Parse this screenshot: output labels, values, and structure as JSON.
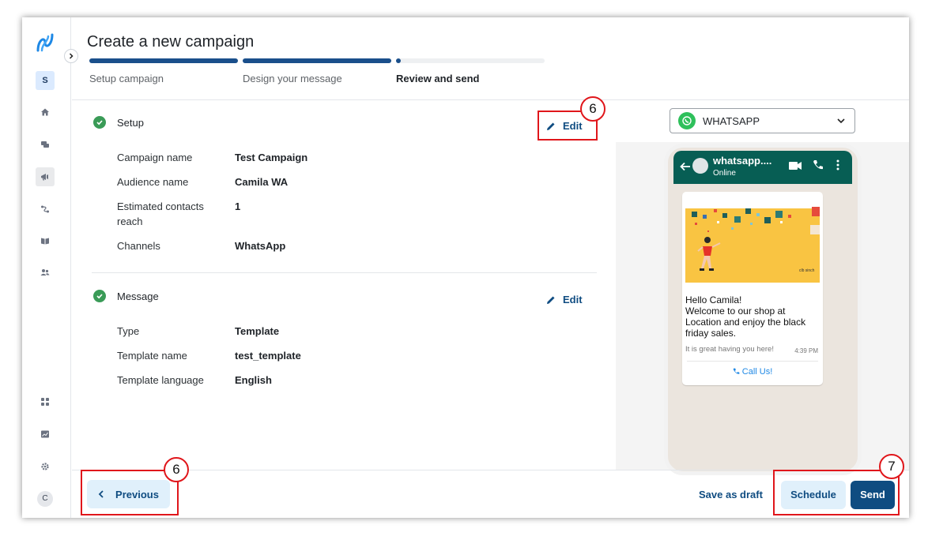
{
  "sidebar": {
    "workspace_initial": "S",
    "user_initial": "C"
  },
  "header": {
    "title": "Create a new campaign",
    "steps": [
      "Setup campaign",
      "Design your message",
      "Review and send"
    ]
  },
  "setup": {
    "heading": "Setup",
    "edit_label": "Edit",
    "rows": [
      {
        "label": "Campaign name",
        "value": "Test Campaign"
      },
      {
        "label": "Audience name",
        "value": "Camila WA"
      },
      {
        "label_line1": "Estimated contacts",
        "label_line2": "reach",
        "value": "1"
      },
      {
        "label": "Channels",
        "value": "WhatsApp"
      }
    ]
  },
  "message": {
    "heading": "Message",
    "edit_label": "Edit",
    "rows": [
      {
        "label": "Type",
        "value": "Template"
      },
      {
        "label": "Template name",
        "value": "test_template"
      },
      {
        "label": "Template language",
        "value": "English"
      }
    ]
  },
  "preview": {
    "channel": "WHATSAPP",
    "contact_name": "whatsapp....",
    "contact_status": "Online",
    "image_brand": "clb sinch",
    "message_lines": [
      "Hello Camila!",
      "Welcome to our shop at Location and enjoy the black friday sales."
    ],
    "footer": "It is great having you here!",
    "time": "4:39 PM",
    "cta": "Call Us!"
  },
  "footer": {
    "previous": "Previous",
    "save_draft": "Save as draft",
    "schedule": "Schedule",
    "send": "Send"
  },
  "annotations": {
    "edit_badge": "6",
    "previous_badge": "6",
    "actions_badge": "7"
  },
  "colors": {
    "primary": "#0f4c81",
    "progress": "#1a4f8b",
    "success": "#3a9b57",
    "annotation": "#e0161b",
    "whatsapp": "#075e54"
  }
}
